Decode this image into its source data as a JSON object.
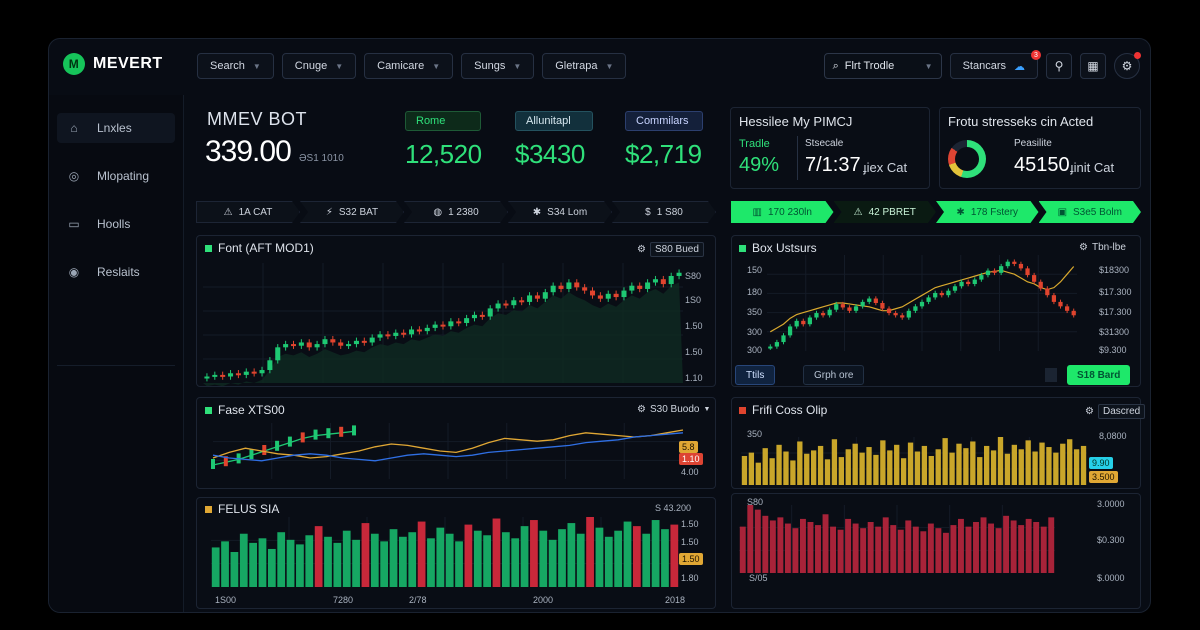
{
  "app": {
    "name": "MEVERT",
    "logo_mark": "M"
  },
  "topnav": [
    {
      "label": "Search"
    },
    {
      "label": "Cnuge"
    },
    {
      "label": "Camicare"
    },
    {
      "label": "Sungs"
    },
    {
      "label": "Gletrapa"
    }
  ],
  "topright": {
    "search_label": "Flrt Trodle",
    "account_label": "Stancars",
    "notification_count": "3"
  },
  "sidebar": [
    {
      "label": "Lnxles",
      "icon": "home-icon",
      "glyph": "⌂"
    },
    {
      "label": "Mlopating",
      "icon": "pin-icon",
      "glyph": "◎"
    },
    {
      "label": "Hoolls",
      "icon": "folder-icon",
      "glyph": "▭"
    },
    {
      "label": "Reslaits",
      "icon": "gauge-icon",
      "glyph": "◉"
    }
  ],
  "bot": {
    "title": "MMEV BOT",
    "value": "339.00",
    "sub": "ƏS1 1010"
  },
  "stats": [
    {
      "label": "Rome",
      "value": "12,520",
      "label_bg": "#0d2a1a",
      "label_fg": "#2fe07a"
    },
    {
      "label": "Allunitapl",
      "value": "$3430",
      "label_bg": "#12303c",
      "label_fg": "#d5e6ee"
    },
    {
      "label": "Commilars",
      "value": "$2,719",
      "label_bg": "#14203a",
      "label_fg": "#c8d4ff"
    }
  ],
  "panel_left": {
    "title": "Hessilee My PIMCJ",
    "k1_label": "Tradle",
    "k1_value": "49%",
    "k2_label": "Stsecale",
    "k2_value": "7/1:37",
    "k2_suffix": "ɟiex Cat"
  },
  "panel_right": {
    "title": "Frotu stresseks cin Acted",
    "k_label": "Peasilite",
    "k_value": "45150",
    "k_suffix": "ɟinit Cat"
  },
  "strip_left": [
    {
      "icon": "alert-icon",
      "glyph": "⚠",
      "label": "1A CAT"
    },
    {
      "icon": "bolt-icon",
      "glyph": "⚡",
      "label": "S32 BAT"
    },
    {
      "icon": "coin-icon",
      "glyph": "◍",
      "label": "1 2380"
    },
    {
      "icon": "star-icon",
      "glyph": "✱",
      "label": "S34 Lom"
    },
    {
      "icon": "dollar-icon",
      "glyph": "$",
      "label": "1 S80"
    }
  ],
  "strip_right": [
    {
      "icon": "bars-icon",
      "glyph": "▥",
      "label": "170 230ln",
      "style": "g"
    },
    {
      "icon": "alert-icon",
      "glyph": "⚠",
      "label": "42 PBRET",
      "style": "d"
    },
    {
      "icon": "star-icon",
      "glyph": "✱",
      "label": "178 Fstery",
      "style": "g"
    },
    {
      "icon": "box-icon",
      "glyph": "▣",
      "label": "S3e5 Bolm",
      "style": "g"
    }
  ],
  "chart1": {
    "title": "Font (AFT MOD1)",
    "control": "S80 Bued",
    "y_ticks": [
      "S80",
      "1S0",
      "1.50",
      "1.50",
      "1.10"
    ],
    "color_up": "#1ec873",
    "color_down": "#e0442e"
  },
  "chart2": {
    "title": "Box Ustsurs",
    "right_label": "Tbn-lbe",
    "y_left": [
      "150",
      "180",
      "350",
      "300",
      "300"
    ],
    "y_right": [
      "$18300",
      "$17.300",
      "$17.300",
      "$31300",
      "$9.300"
    ],
    "tab1": "Ttils",
    "tab2": "Grph ore",
    "action": "S18 Bard"
  },
  "chart3": {
    "title": "Fase XTS00",
    "control": "S30 Buodo",
    "tag1": "5.8",
    "tag2": "1.10",
    "tag3": "4.00"
  },
  "chart4": {
    "title": "Frifi Coss Olip",
    "control": "Dascred",
    "y_left_top": "350",
    "y_right": [
      "8,0800",
      "6.00"
    ],
    "tag1": "9.90",
    "tag2": "3.500"
  },
  "chart5": {
    "title": "FELUS SIA",
    "right_top": "S 43.200",
    "y_right": [
      "1.50",
      "1.50",
      "1.80"
    ],
    "tag": "1.50",
    "x_ticks": [
      "1S00",
      "7280",
      "2/78",
      "2000",
      "2018"
    ]
  },
  "chart6": {
    "y_left_top": "S80",
    "x_left": "S/05",
    "y_right": [
      "3.0000",
      "$0.300",
      "$.0000"
    ]
  },
  "chart_data": [
    {
      "type": "candlestick",
      "title": "Font (AFT MOD1)",
      "close": [
        10,
        11,
        10,
        12,
        11,
        13,
        12,
        14,
        20,
        28,
        30,
        29,
        31,
        28,
        30,
        33,
        31,
        29,
        30,
        32,
        31,
        34,
        36,
        35,
        37,
        36,
        39,
        38,
        40,
        42,
        41,
        44,
        43,
        46,
        48,
        47,
        52,
        55,
        54,
        57,
        56,
        60,
        58,
        62,
        66,
        64,
        68,
        65,
        63,
        60,
        58,
        61,
        59,
        63,
        66,
        64,
        68,
        70,
        67,
        72,
        74
      ],
      "color_up": "#1ec873",
      "color_down": "#e0442e"
    },
    {
      "type": "candlestick",
      "title": "Box Ustsurs",
      "close": [
        12,
        16,
        22,
        30,
        35,
        32,
        38,
        42,
        40,
        45,
        50,
        47,
        44,
        48,
        52,
        55,
        51,
        46,
        42,
        40,
        38,
        44,
        48,
        52,
        56,
        60,
        58,
        62,
        66,
        70,
        68,
        72,
        76,
        80,
        78,
        84,
        88,
        86,
        82,
        76,
        70,
        64,
        58,
        52,
        48,
        44,
        40
      ],
      "overlay": [
        20,
        24,
        28,
        34,
        38,
        40,
        42,
        44,
        46,
        48,
        50,
        50,
        49,
        48,
        47,
        46,
        44,
        42,
        42,
        44,
        46,
        50,
        54,
        58,
        62,
        66,
        68,
        70,
        72,
        74,
        76,
        78,
        80,
        82,
        83,
        84,
        82,
        80,
        76,
        72,
        70,
        66,
        64,
        66,
        72,
        80,
        88
      ]
    },
    {
      "type": "line",
      "title": "Fase XTS00",
      "series": [
        {
          "color": "#1ec873",
          "values": [
            20,
            24,
            28,
            34,
            40,
            46,
            52,
            58,
            62,
            64,
            66,
            68
          ]
        },
        {
          "color": "#e0a734",
          "values": [
            30,
            38,
            44,
            40,
            36,
            34,
            30,
            32,
            36,
            40,
            46,
            50,
            48,
            44,
            40,
            38,
            44,
            52,
            58,
            56,
            54,
            56,
            62,
            66,
            64,
            62,
            60,
            62,
            66,
            70
          ]
        },
        {
          "color": "#2f6fe4",
          "values": [
            34,
            30,
            28,
            26,
            30,
            34,
            36,
            34,
            30,
            28,
            26,
            30,
            34,
            36,
            34,
            32,
            34,
            38,
            40,
            42,
            44,
            46,
            48,
            52,
            54,
            56,
            60,
            62,
            64,
            66
          ]
        }
      ]
    },
    {
      "type": "bar",
      "title": "Frifi Coss Olip",
      "values": [
        52,
        58,
        40,
        66,
        48,
        72,
        60,
        44,
        78,
        56,
        62,
        70,
        46,
        82,
        50,
        64,
        74,
        58,
        68,
        54,
        80,
        62,
        72,
        48,
        76,
        60,
        70,
        52,
        64,
        84,
        58,
        74,
        66,
        78,
        50,
        70,
        62,
        86,
        56,
        72,
        64,
        80,
        60,
        76,
        68,
        58,
        74,
        82,
        64,
        70
      ],
      "color": "#c9a62a"
    },
    {
      "type": "bar",
      "title": "FELUS SIA",
      "values": [
        52,
        60,
        46,
        70,
        58,
        64,
        50,
        72,
        62,
        56,
        68,
        80,
        66,
        58,
        74,
        62,
        84,
        70,
        60,
        76,
        66,
        72,
        86,
        64,
        78,
        70,
        60,
        82,
        74,
        68,
        90,
        72,
        64,
        80,
        88,
        74,
        62,
        76,
        84,
        70,
        92,
        78,
        66,
        74,
        86,
        80,
        70,
        88,
        76,
        82
      ],
      "red_index": [
        11,
        16,
        22,
        27,
        30,
        34,
        40,
        45,
        49
      ],
      "color": "#16a763",
      "color_alt": "#c8283a"
    },
    {
      "type": "bar",
      "title": "",
      "values": [
        60,
        88,
        82,
        74,
        68,
        72,
        64,
        58,
        70,
        66,
        62,
        76,
        60,
        56,
        70,
        64,
        58,
        66,
        60,
        72,
        62,
        56,
        68,
        60,
        54,
        64,
        58,
        52,
        62,
        70,
        60,
        66,
        72,
        64,
        58,
        74,
        68,
        62,
        70,
        66,
        60,
        72
      ],
      "color": "#a82339"
    }
  ]
}
